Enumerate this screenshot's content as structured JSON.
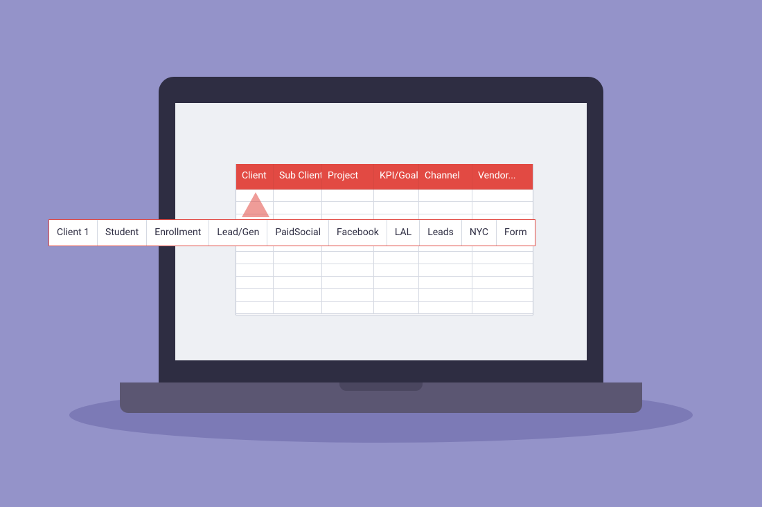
{
  "spreadsheet": {
    "headers": [
      "Client",
      "Sub Client",
      "Project",
      "KPI/Goal",
      "Channel",
      "Vendor..."
    ]
  },
  "callout": {
    "cells": [
      "Client 1",
      "Student",
      "Enrollment",
      "Lead/Gen",
      "PaidSocial",
      "Facebook",
      "LAL",
      "Leads",
      "NYC",
      "Form"
    ]
  }
}
